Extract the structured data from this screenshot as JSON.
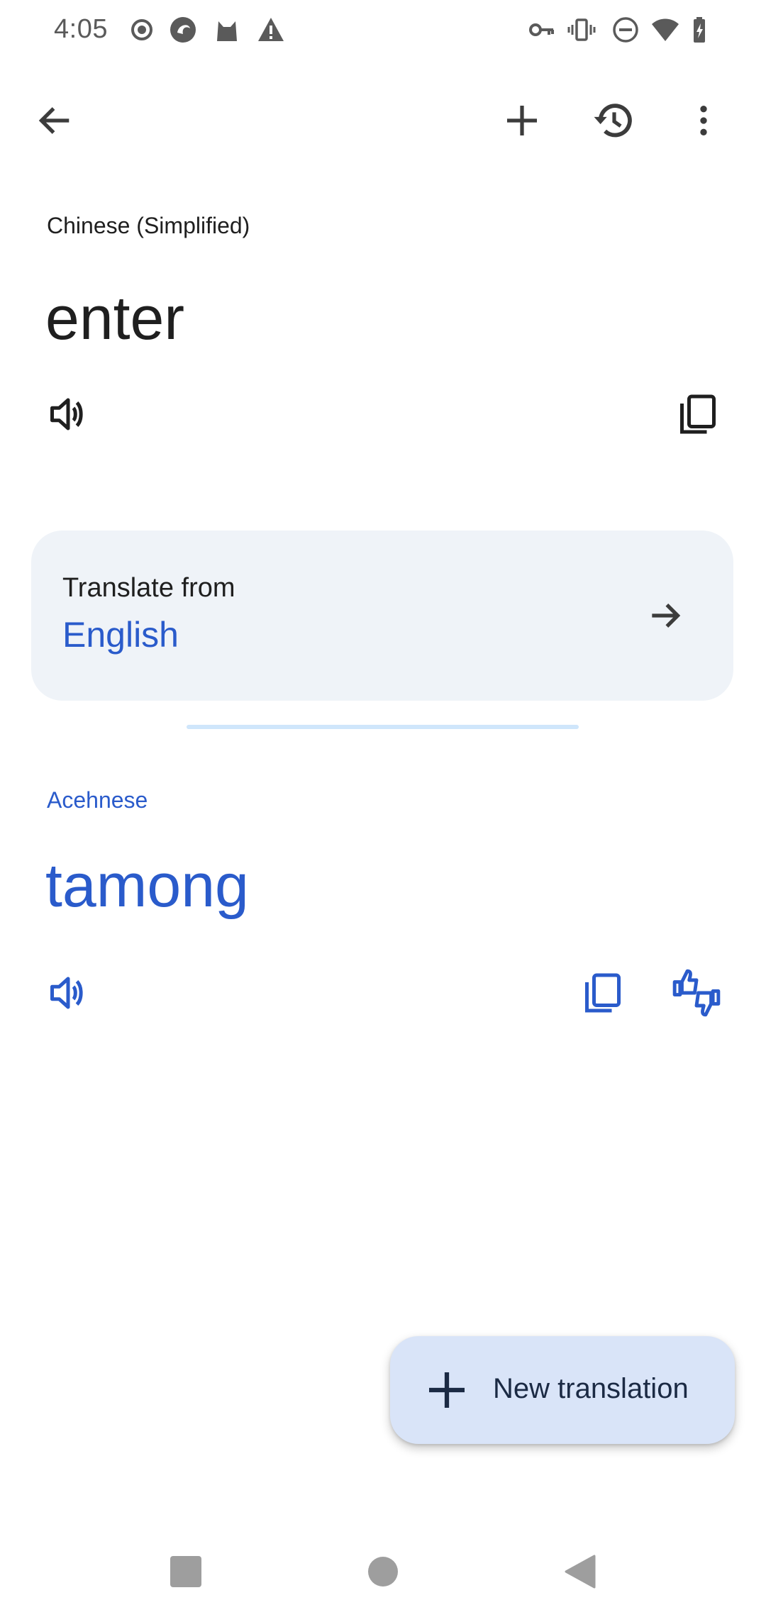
{
  "status_bar": {
    "time": "4:05",
    "left_icons": [
      "record-icon",
      "app-icon",
      "cat-icon",
      "warning-icon"
    ],
    "right_icons": [
      "vpn-key-icon",
      "vibrate-icon",
      "dnd-icon",
      "wifi-icon",
      "battery-icon"
    ]
  },
  "app_bar": {
    "back_icon": "arrow-back-icon",
    "add_icon": "plus-icon",
    "history_icon": "history-icon",
    "more_icon": "more-vert-icon"
  },
  "source": {
    "language": "Chinese (Simplified)",
    "text": "enter"
  },
  "translate_from": {
    "label": "Translate from",
    "language": "English"
  },
  "target": {
    "language": "Acehnese",
    "text": "tamong"
  },
  "fab": {
    "label": "New translation"
  },
  "colors": {
    "accent": "#2a5bcb",
    "card_bg": "#eff3f8",
    "fab_bg": "#d9e4f8",
    "divider": "#cfe6fb"
  }
}
